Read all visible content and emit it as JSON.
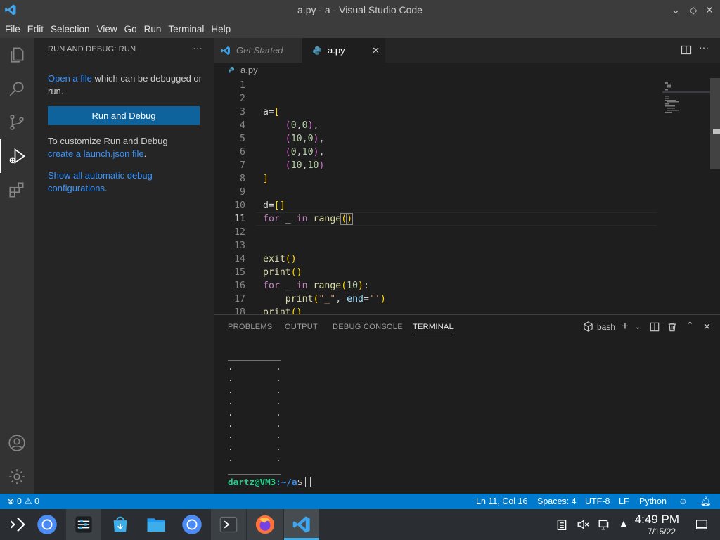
{
  "window": {
    "title": "a.py - a - Visual Studio Code"
  },
  "menu": [
    "File",
    "Edit",
    "Selection",
    "View",
    "Go",
    "Run",
    "Terminal",
    "Help"
  ],
  "activity_bar": {
    "items": [
      "explorer-icon",
      "search-icon",
      "source-control-icon",
      "run-debug-icon",
      "extensions-icon"
    ],
    "bottom": [
      "account-icon",
      "manage-gear-icon"
    ],
    "active": "run-debug-icon"
  },
  "sidebar": {
    "title": "RUN AND DEBUG: RUN",
    "open_file_link": "Open a file",
    "open_file_rest": " which can be debugged or run.",
    "run_button": "Run and Debug",
    "customize_text": "To customize Run and Debug",
    "launch_link": "create a launch.json file",
    "launch_rest": ".",
    "show_all_link": "Show all automatic debug configurations",
    "show_all_rest": "."
  },
  "tabs": [
    {
      "label": "Get Started",
      "active": false
    },
    {
      "label": "a.py",
      "active": true
    }
  ],
  "breadcrumb": "a.py",
  "editor": {
    "current_line": 11,
    "lines": [
      {
        "n": "1",
        "html": ""
      },
      {
        "n": "2",
        "html": ""
      },
      {
        "n": "3",
        "html": "a=<span class='br1'>[</span>"
      },
      {
        "n": "4",
        "html": "    <span class='br2'>(</span><span class='num'>0</span>,<span class='num'>0</span><span class='br2'>)</span>,"
      },
      {
        "n": "5",
        "html": "    <span class='br2'>(</span><span class='num'>10</span>,<span class='num'>0</span><span class='br2'>)</span>,"
      },
      {
        "n": "6",
        "html": "    <span class='br2'>(</span><span class='num'>0</span>,<span class='num'>10</span><span class='br2'>)</span>,"
      },
      {
        "n": "7",
        "html": "    <span class='br2'>(</span><span class='num'>10</span>,<span class='num'>10</span><span class='br2'>)</span>"
      },
      {
        "n": "8",
        "html": "<span class='br1'>]</span>"
      },
      {
        "n": "9",
        "html": ""
      },
      {
        "n": "10",
        "html": "d=<span class='br1'>[]</span>"
      },
      {
        "n": "11",
        "html": "<span class='kw'>for</span> _ <span class='kw'>in</span> <span class='fn'>range</span><span class='br1' style='outline:1px solid #888'>(</span><span class='br1' style='outline:1px solid #888'>)</span>"
      },
      {
        "n": "12",
        "html": ""
      },
      {
        "n": "13",
        "html": ""
      },
      {
        "n": "14",
        "html": "<span class='fn'>exit</span><span class='br1'>()</span>"
      },
      {
        "n": "15",
        "html": "<span class='fn'>print</span><span class='br1'>()</span>"
      },
      {
        "n": "16",
        "html": "<span class='kw'>for</span> _ <span class='kw'>in</span> <span class='fn'>range</span><span class='br1'>(</span><span class='num'>10</span><span class='br1'>)</span>:"
      },
      {
        "n": "17",
        "html": "    <span class='fn'>print</span><span class='br1'>(</span><span class='str'>\"_\"</span>, <span class='var'>end</span>=<span class='str'>''</span><span class='br1'>)</span>"
      },
      {
        "n": "18",
        "html": "<span class='fn'>print</span><span class='br1'>()</span>"
      }
    ]
  },
  "panel": {
    "tabs": [
      "PROBLEMS",
      "OUTPUT",
      "DEBUG CONSOLE",
      "TERMINAL"
    ],
    "active_tab": "TERMINAL",
    "shell": "bash"
  },
  "terminal": {
    "lines": [
      "__________",
      ".        .",
      ".        .",
      ".        .",
      ".        .",
      ".        .",
      ".        .",
      ".        .",
      ".        .",
      ".        .",
      "__________"
    ],
    "prompt_user": "dartz@VM3",
    "prompt_path": ":~/a",
    "prompt_symbol": "$"
  },
  "status": {
    "errors": "0",
    "warnings": "0",
    "position": "Ln 11, Col 16",
    "spaces": "Spaces: 4",
    "encoding": "UTF-8",
    "eol": "LF",
    "language": "Python"
  },
  "taskbar": {
    "apps": [
      "app-launcher-icon",
      "chromium-icon",
      "system-settings-icon",
      "discover-store-icon",
      "file-manager-icon",
      "chromium-icon",
      "terminal-icon",
      "firefox-icon",
      "vscode-icon"
    ],
    "time": "4:49 PM",
    "date": "7/15/22"
  },
  "colors": {
    "accent": "#007acc",
    "button": "#0e639c",
    "link": "#3794ff"
  }
}
